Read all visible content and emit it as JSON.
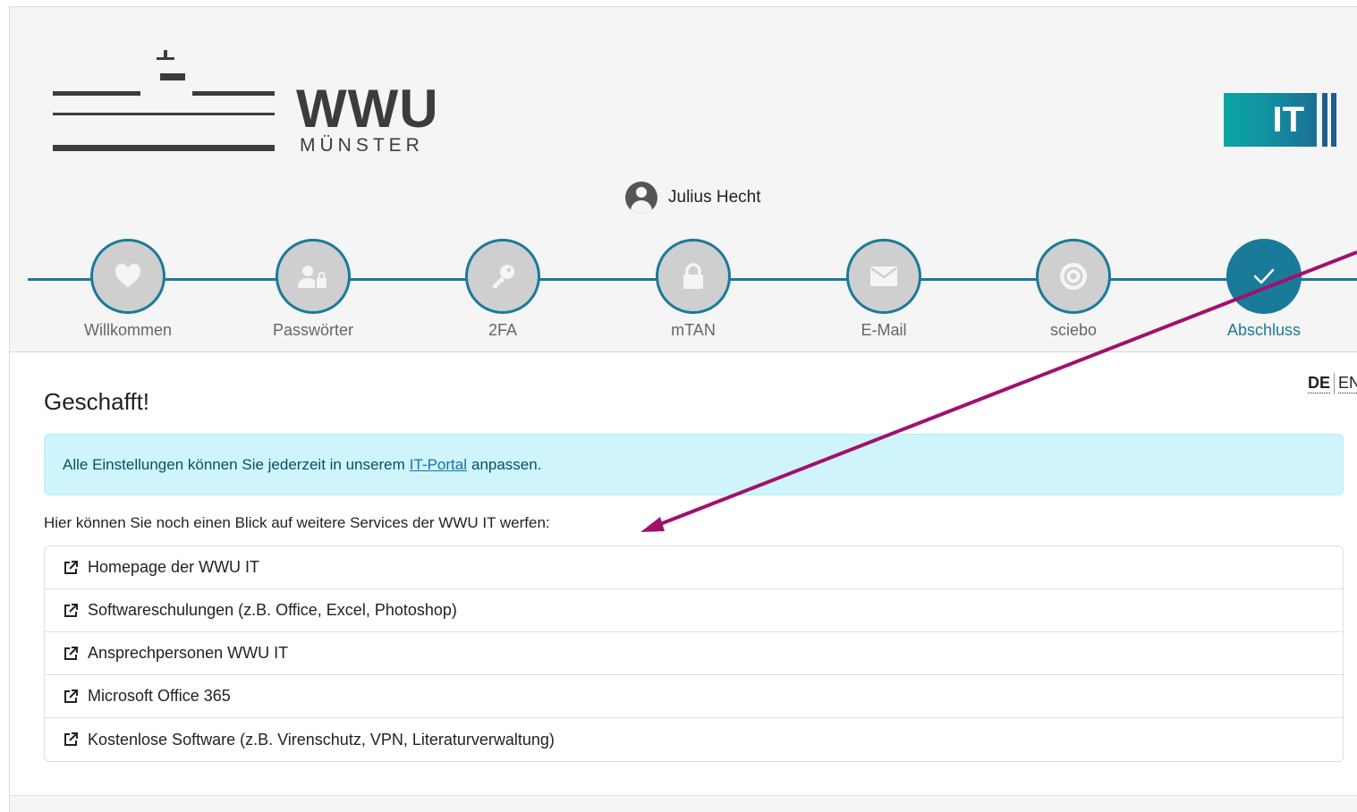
{
  "header": {
    "logo": {
      "word": "WWU",
      "sub": "MÜNSTER"
    },
    "it_logo": {
      "text": "IT"
    },
    "user": {
      "name": "Julius Hecht",
      "icon": "user-circle-icon"
    }
  },
  "steps": [
    {
      "label": "Willkommen",
      "icon": "heart-icon",
      "active": false
    },
    {
      "label": "Passwörter",
      "icon": "user-lock-icon",
      "active": false
    },
    {
      "label": "2FA",
      "icon": "key-icon",
      "active": false
    },
    {
      "label": "mTAN",
      "icon": "lock-icon",
      "active": false
    },
    {
      "label": "E-Mail",
      "icon": "envelope-icon",
      "active": false
    },
    {
      "label": "sciebo",
      "icon": "sciebo-icon",
      "active": false
    },
    {
      "label": "Abschluss",
      "icon": "check-icon",
      "active": true
    }
  ],
  "language": {
    "de": "DE",
    "en": "EN"
  },
  "main": {
    "title": "Geschafft!",
    "alert": {
      "before": "Alle Einstellungen können Sie jederzeit in unserem",
      "link": "IT-Portal",
      "after": "anpassen."
    },
    "intro": "Hier können Sie noch einen Blick auf weitere Services der WWU IT werfen:",
    "links": [
      "Homepage der WWU IT",
      "Softwareschulungen (z.B. Office, Excel, Photoshop)",
      "Ansprechpersonen WWU IT",
      "Microsoft Office 365",
      "Kostenlose Software (z.B. Virenschutz, VPN, Literaturverwaltung)"
    ]
  },
  "colors": {
    "accent": "#1a7a9a",
    "alert_bg": "#cff4fc",
    "annotation_arrow": "#a0106e"
  }
}
